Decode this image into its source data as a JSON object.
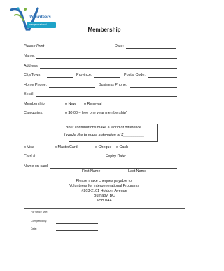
{
  "logo": {
    "brand": "Volunteers",
    "sub": "Intergenerational",
    "colors": {
      "blue": "#2b6cb0",
      "green": "#7cb342",
      "cyan": "#1fa3c8"
    }
  },
  "form": {
    "title": "Membership",
    "please_print": "Please Print",
    "date_label": "Date:",
    "name_label": "Name:",
    "address_label": "Address:",
    "city_label": "City/Town:",
    "province_label": "Province:",
    "postal_label": "Postal Code:",
    "home_phone_label": "Home Phone:",
    "business_phone_label": "Business Phone:",
    "email_label": "Email:",
    "membership_label": "Membership:",
    "membership_new": "o New",
    "membership_renewal": "o Renewal",
    "categories_label": "Categories:",
    "categories_value": "o $0.00 – free one year membership*",
    "box_line1": "Your contributions make a world of difference.",
    "box_line2": "I would like to make a donation of $__________",
    "pay_visa": "o Visa",
    "pay_mastercard": "o MasterCard",
    "pay_cheque": "o Cheque",
    "pay_cash": "o Cash",
    "card_label": "Card #",
    "expiry_label": "Expiry Date:",
    "name_on_card_label": "Name on card:",
    "first_name": "First Name",
    "last_name": "Last Name",
    "payable_line1": "Please make cheques payable to:",
    "payable_line2": "Volunteers for Intergenerational Programs",
    "payable_line3": "#203-2101 Holdom Avenue",
    "payable_line4": "Burnaby, BC",
    "payable_line5": "V5B 0A4"
  },
  "office": {
    "label": "For Office Use:",
    "completed_by": "Completed by:",
    "date": "Date:"
  }
}
